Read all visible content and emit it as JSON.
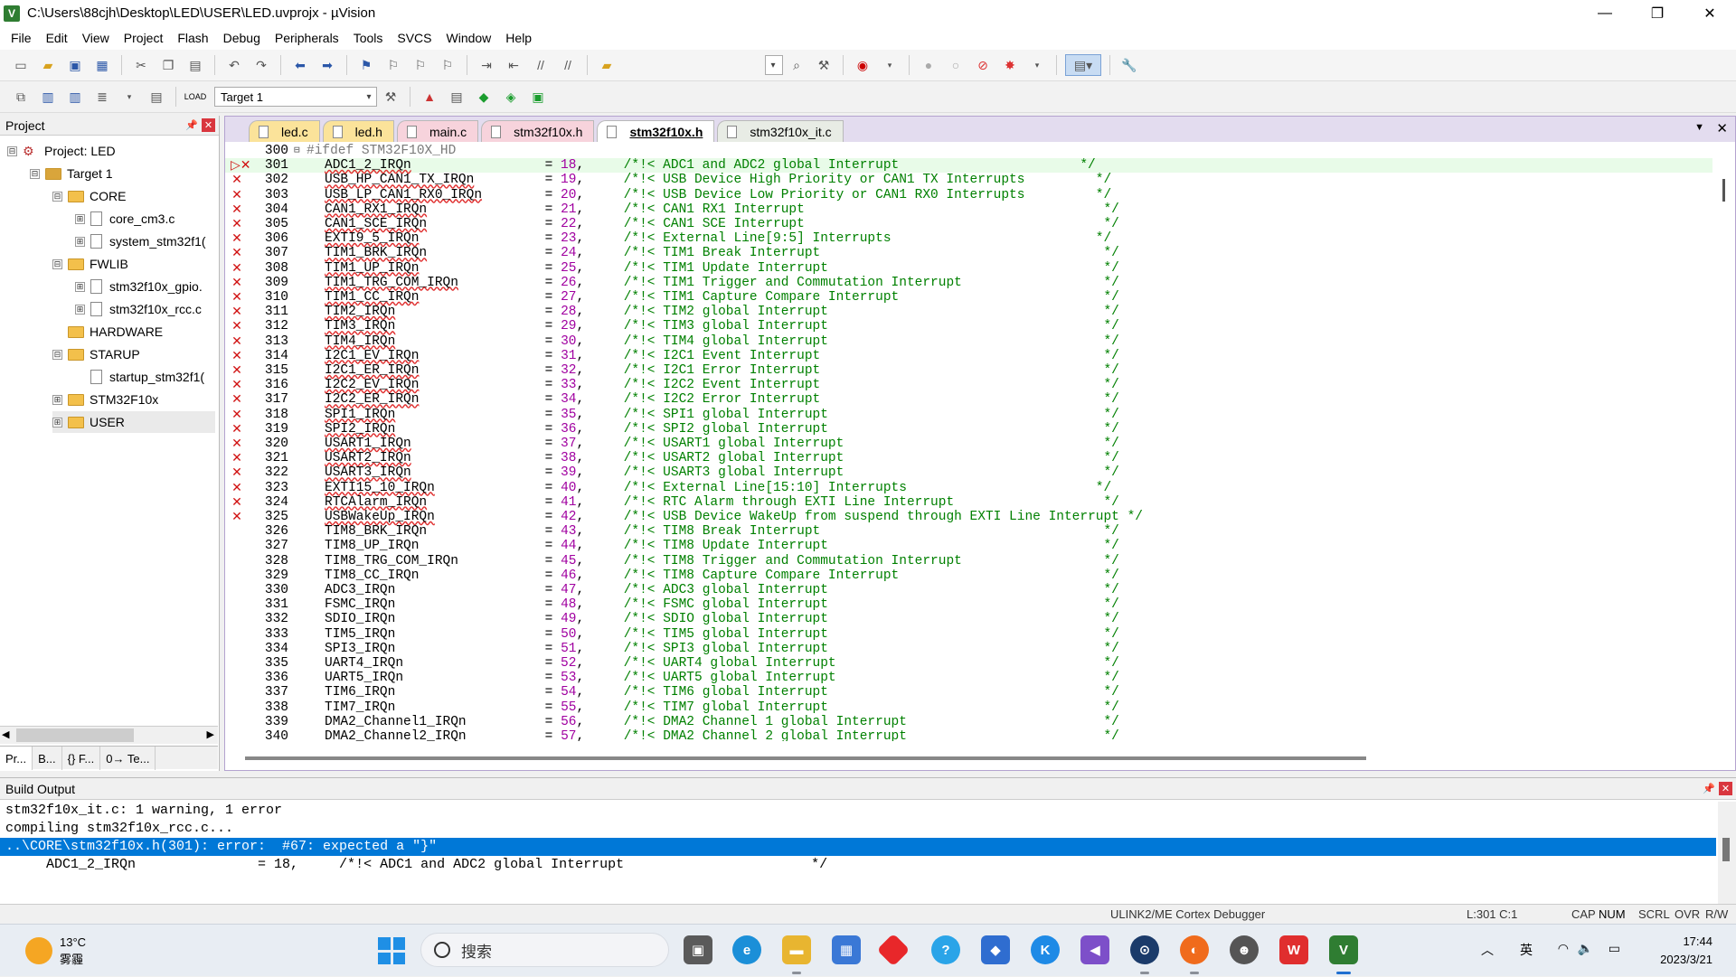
{
  "window": {
    "title": "C:\\Users\\88cjh\\Desktop\\LED\\USER\\LED.uvprojx - µVision",
    "minimize": "—",
    "maximize": "❐",
    "close": "✕"
  },
  "menu": [
    "File",
    "Edit",
    "View",
    "Project",
    "Flash",
    "Debug",
    "Peripherals",
    "Tools",
    "SVCS",
    "Window",
    "Help"
  ],
  "toolbar2": {
    "target": "Target 1"
  },
  "project_pane": {
    "title": "Project",
    "tree": [
      {
        "label": "Project: LED",
        "level": 0,
        "kind": "project",
        "exp": "⊟"
      },
      {
        "label": "Target 1",
        "level": 1,
        "kind": "target",
        "exp": "⊟"
      },
      {
        "label": "CORE",
        "level": 2,
        "kind": "folder",
        "exp": "⊟"
      },
      {
        "label": "core_cm3.c",
        "level": 3,
        "kind": "file",
        "exp": "⊞"
      },
      {
        "label": "system_stm32f1(",
        "level": 3,
        "kind": "file",
        "exp": "⊞"
      },
      {
        "label": "FWLIB",
        "level": 2,
        "kind": "folder",
        "exp": "⊟"
      },
      {
        "label": "stm32f10x_gpio.",
        "level": 3,
        "kind": "file",
        "exp": "⊞"
      },
      {
        "label": "stm32f10x_rcc.c",
        "level": 3,
        "kind": "file",
        "exp": "⊞"
      },
      {
        "label": "HARDWARE",
        "level": 2,
        "kind": "folder",
        "exp": ""
      },
      {
        "label": "STARUP",
        "level": 2,
        "kind": "folder",
        "exp": "⊟"
      },
      {
        "label": "startup_stm32f1(",
        "level": 3,
        "kind": "file",
        "exp": ""
      },
      {
        "label": "STM32F10x",
        "level": 2,
        "kind": "folder",
        "exp": "⊞"
      },
      {
        "label": "USER",
        "level": 2,
        "kind": "folder",
        "exp": "⊞"
      }
    ],
    "tabs": [
      "Pr...",
      "B...",
      "{} F...",
      "0→ Te..."
    ]
  },
  "editor": {
    "tabs": [
      {
        "label": "led.c",
        "color": "yel"
      },
      {
        "label": "led.h",
        "color": "yel"
      },
      {
        "label": "main.c",
        "color": "pnk"
      },
      {
        "label": "stm32f10x.h",
        "color": "pnk"
      },
      {
        "label": "stm32f10x.h",
        "color": "act"
      },
      {
        "label": "stm32f10x_it.c",
        "color": "grn"
      }
    ],
    "header_line": {
      "num": "300",
      "text": "#ifdef STM32F10X_HD"
    },
    "lines": [
      {
        "num": "301",
        "mark": "▷✕",
        "name": "ADC1_2_IRQn",
        "val": "18",
        "cmt": "/*!< ADC1 and ADC2 global Interrupt                       */",
        "err": true
      },
      {
        "num": "302",
        "mark": "✕",
        "name": "USB_HP_CAN1_TX_IRQn",
        "val": "19",
        "cmt": "/*!< USB Device High Priority or CAN1 TX Interrupts         */",
        "err": true
      },
      {
        "num": "303",
        "mark": "✕",
        "name": "USB_LP_CAN1_RX0_IRQn",
        "val": "20",
        "cmt": "/*!< USB Device Low Priority or CAN1 RX0 Interrupts         */",
        "err": true
      },
      {
        "num": "304",
        "mark": "✕",
        "name": "CAN1_RX1_IRQn",
        "val": "21",
        "cmt": "/*!< CAN1 RX1 Interrupt                                      */",
        "err": true
      },
      {
        "num": "305",
        "mark": "✕",
        "name": "CAN1_SCE_IRQn",
        "val": "22",
        "cmt": "/*!< CAN1 SCE Interrupt                                      */",
        "err": true
      },
      {
        "num": "306",
        "mark": "✕",
        "name": "EXTI9_5_IRQn",
        "val": "23",
        "cmt": "/*!< External Line[9:5] Interrupts                          */",
        "err": true
      },
      {
        "num": "307",
        "mark": "✕",
        "name": "TIM1_BRK_IRQn",
        "val": "24",
        "cmt": "/*!< TIM1 Break Interrupt                                    */",
        "err": true
      },
      {
        "num": "308",
        "mark": "✕",
        "name": "TIM1_UP_IRQn",
        "val": "25",
        "cmt": "/*!< TIM1 Update Interrupt                                   */",
        "err": true
      },
      {
        "num": "309",
        "mark": "✕",
        "name": "TIM1_TRG_COM_IRQn",
        "val": "26",
        "cmt": "/*!< TIM1 Trigger and Commutation Interrupt                  */",
        "err": true
      },
      {
        "num": "310",
        "mark": "✕",
        "name": "TIM1_CC_IRQn",
        "val": "27",
        "cmt": "/*!< TIM1 Capture Compare Interrupt                          */",
        "err": true
      },
      {
        "num": "311",
        "mark": "✕",
        "name": "TIM2_IRQn",
        "val": "28",
        "cmt": "/*!< TIM2 global Interrupt                                   */",
        "err": true
      },
      {
        "num": "312",
        "mark": "✕",
        "name": "TIM3_IRQn",
        "val": "29",
        "cmt": "/*!< TIM3 global Interrupt                                   */",
        "err": true
      },
      {
        "num": "313",
        "mark": "✕",
        "name": "TIM4_IRQn",
        "val": "30",
        "cmt": "/*!< TIM4 global Interrupt                                   */",
        "err": true
      },
      {
        "num": "314",
        "mark": "✕",
        "name": "I2C1_EV_IRQn",
        "val": "31",
        "cmt": "/*!< I2C1 Event Interrupt                                    */",
        "err": true
      },
      {
        "num": "315",
        "mark": "✕",
        "name": "I2C1_ER_IRQn",
        "val": "32",
        "cmt": "/*!< I2C1 Error Interrupt                                    */",
        "err": true
      },
      {
        "num": "316",
        "mark": "✕",
        "name": "I2C2_EV_IRQn",
        "val": "33",
        "cmt": "/*!< I2C2 Event Interrupt                                    */",
        "err": true
      },
      {
        "num": "317",
        "mark": "✕",
        "name": "I2C2_ER_IRQn",
        "val": "34",
        "cmt": "/*!< I2C2 Error Interrupt                                    */",
        "err": true
      },
      {
        "num": "318",
        "mark": "✕",
        "name": "SPI1_IRQn",
        "val": "35",
        "cmt": "/*!< SPI1 global Interrupt                                   */",
        "err": true
      },
      {
        "num": "319",
        "mark": "✕",
        "name": "SPI2_IRQn",
        "val": "36",
        "cmt": "/*!< SPI2 global Interrupt                                   */",
        "err": true
      },
      {
        "num": "320",
        "mark": "✕",
        "name": "USART1_IRQn",
        "val": "37",
        "cmt": "/*!< USART1 global Interrupt                                 */",
        "err": true
      },
      {
        "num": "321",
        "mark": "✕",
        "name": "USART2_IRQn",
        "val": "38",
        "cmt": "/*!< USART2 global Interrupt                                 */",
        "err": true
      },
      {
        "num": "322",
        "mark": "✕",
        "name": "USART3_IRQn",
        "val": "39",
        "cmt": "/*!< USART3 global Interrupt                                 */",
        "err": true
      },
      {
        "num": "323",
        "mark": "✕",
        "name": "EXTI15_10_IRQn",
        "val": "40",
        "cmt": "/*!< External Line[15:10] Interrupts                        */",
        "err": true
      },
      {
        "num": "324",
        "mark": "✕",
        "name": "RTCAlarm_IRQn",
        "val": "41",
        "cmt": "/*!< RTC Alarm through EXTI Line Interrupt                   */",
        "err": true
      },
      {
        "num": "325",
        "mark": "✕",
        "name": "USBWakeUp_IRQn",
        "val": "42",
        "cmt": "/*!< USB Device WakeUp from suspend through EXTI Line Interrupt */",
        "err": true
      },
      {
        "num": "326",
        "mark": "",
        "name": "TIM8_BRK_IRQn",
        "val": "43",
        "cmt": "/*!< TIM8 Break Interrupt                                    */",
        "err": false
      },
      {
        "num": "327",
        "mark": "",
        "name": "TIM8_UP_IRQn",
        "val": "44",
        "cmt": "/*!< TIM8 Update Interrupt                                   */",
        "err": false
      },
      {
        "num": "328",
        "mark": "",
        "name": "TIM8_TRG_COM_IRQn",
        "val": "45",
        "cmt": "/*!< TIM8 Trigger and Commutation Interrupt                  */",
        "err": false
      },
      {
        "num": "329",
        "mark": "",
        "name": "TIM8_CC_IRQn",
        "val": "46",
        "cmt": "/*!< TIM8 Capture Compare Interrupt                          */",
        "err": false
      },
      {
        "num": "330",
        "mark": "",
        "name": "ADC3_IRQn",
        "val": "47",
        "cmt": "/*!< ADC3 global Interrupt                                   */",
        "err": false
      },
      {
        "num": "331",
        "mark": "",
        "name": "FSMC_IRQn",
        "val": "48",
        "cmt": "/*!< FSMC global Interrupt                                   */",
        "err": false
      },
      {
        "num": "332",
        "mark": "",
        "name": "SDIO_IRQn",
        "val": "49",
        "cmt": "/*!< SDIO global Interrupt                                   */",
        "err": false
      },
      {
        "num": "333",
        "mark": "",
        "name": "TIM5_IRQn",
        "val": "50",
        "cmt": "/*!< TIM5 global Interrupt                                   */",
        "err": false
      },
      {
        "num": "334",
        "mark": "",
        "name": "SPI3_IRQn",
        "val": "51",
        "cmt": "/*!< SPI3 global Interrupt                                   */",
        "err": false
      },
      {
        "num": "335",
        "mark": "",
        "name": "UART4_IRQn",
        "val": "52",
        "cmt": "/*!< UART4 global Interrupt                                  */",
        "err": false
      },
      {
        "num": "336",
        "mark": "",
        "name": "UART5_IRQn",
        "val": "53",
        "cmt": "/*!< UART5 global Interrupt                                  */",
        "err": false
      },
      {
        "num": "337",
        "mark": "",
        "name": "TIM6_IRQn",
        "val": "54",
        "cmt": "/*!< TIM6 global Interrupt                                   */",
        "err": false
      },
      {
        "num": "338",
        "mark": "",
        "name": "TIM7_IRQn",
        "val": "55",
        "cmt": "/*!< TIM7 global Interrupt                                   */",
        "err": false
      },
      {
        "num": "339",
        "mark": "",
        "name": "DMA2_Channel1_IRQn",
        "val": "56",
        "cmt": "/*!< DMA2 Channel 1 global Interrupt                         */",
        "err": false
      },
      {
        "num": "340",
        "mark": "",
        "name": "DMA2_Channel2_IRQn",
        "val": "57",
        "cmt": "/*!< DMA2 Channel 2 global Interrupt                         */",
        "err": false
      }
    ]
  },
  "build_output": {
    "title": "Build Output",
    "lines": [
      "stm32f10x_it.c: 1 warning, 1 error",
      "compiling stm32f10x_rcc.c...",
      "..\\CORE\\stm32f10x.h(301): error:  #67: expected a \"}\"",
      "     ADC1_2_IRQn               = 18,     /*!< ADC1 and ADC2 global Interrupt                       */"
    ],
    "selected": 2
  },
  "status": {
    "debugger": "ULINK2/ME Cortex Debugger",
    "pos": "L:301 C:1",
    "caps": "CAP",
    "num": "NUM",
    "scrl": "SCRL",
    "ovr": "OVR",
    "rw": "R/W"
  },
  "taskbar": {
    "temp": "13°C",
    "weather": "雾霾",
    "search": "搜索",
    "lang": "英",
    "time": "17:44",
    "date": "2023/3/21"
  }
}
